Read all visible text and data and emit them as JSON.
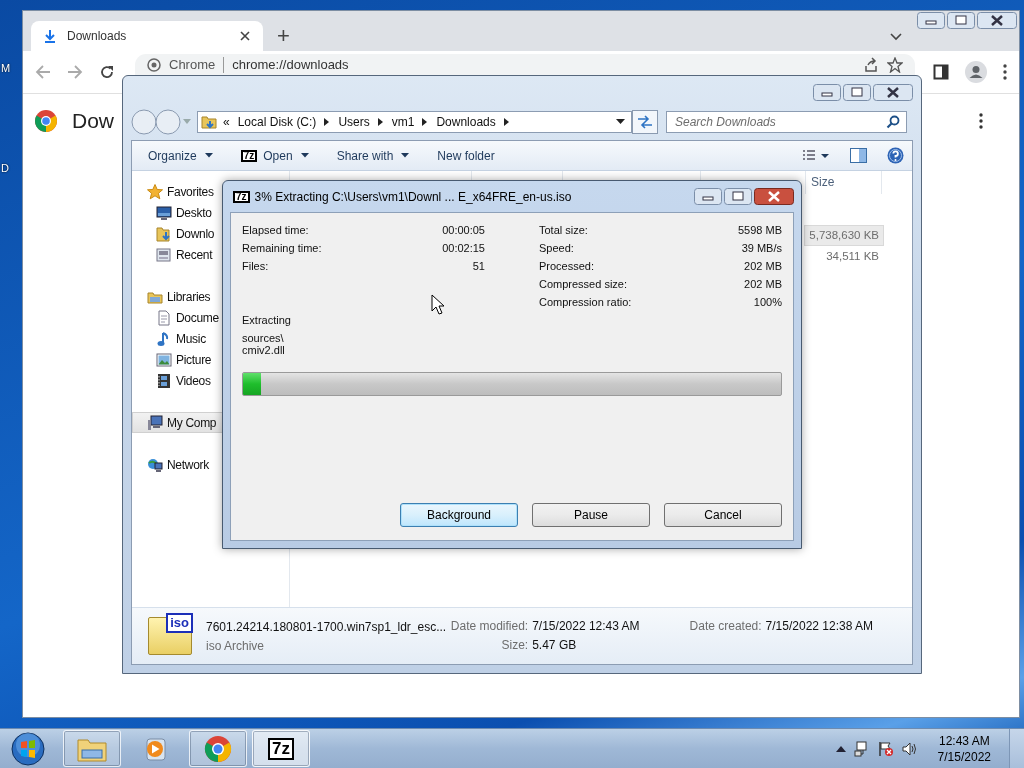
{
  "desktop": {
    "icon_labels": [
      "M",
      "D"
    ]
  },
  "browser": {
    "tabs": [
      {
        "title": "Downloads",
        "selected": true
      }
    ],
    "new_tab": "+",
    "omnibox": {
      "site_label": "Chrome",
      "url": "chrome://downloads"
    },
    "page_heading": "Dow"
  },
  "explorer": {
    "path_overflow": "«",
    "breadcrumb": [
      "Local Disk (C:)",
      "Users",
      "vm1",
      "Downloads"
    ],
    "search": {
      "placeholder": "Search Downloads"
    },
    "commands": [
      {
        "label": "Organize",
        "dropdown": true
      },
      {
        "label": "Open",
        "dropdown": true,
        "icon_text": "7z"
      },
      {
        "label": "Share with",
        "dropdown": true
      },
      {
        "label": "New folder",
        "dropdown": false
      }
    ],
    "nav": [
      {
        "label": "Favorites",
        "selected": false,
        "children": [
          {
            "label": "Deskto",
            "selected": false
          },
          {
            "label": "Downlo",
            "selected": false
          },
          {
            "label": "Recent",
            "selected": false
          }
        ]
      },
      {
        "label": "Libraries",
        "selected": false,
        "children": [
          {
            "label": "Docume",
            "selected": false
          },
          {
            "label": "Music",
            "selected": false
          },
          {
            "label": "Picture",
            "selected": false
          },
          {
            "label": "Videos",
            "selected": false
          }
        ]
      },
      {
        "label": "My Comp",
        "selected": true
      },
      {
        "label": "Network",
        "selected": false
      }
    ],
    "size_column": "Size",
    "rows": [
      {
        "size": "5,738,630 KB",
        "selected": true
      },
      {
        "size": "34,511 KB",
        "selected": false
      }
    ],
    "details": {
      "icon_text": "iso",
      "name": "7601.24214.180801-1700.win7sp1_ldr_esc...",
      "type": "iso Archive",
      "fields": [
        {
          "label": "Date modified:",
          "value": "7/15/2022 12:43 AM"
        },
        {
          "label": "Size:",
          "value": "5.47 GB"
        },
        {
          "label": "Date created:",
          "value": "7/15/2022 12:38 AM"
        }
      ]
    }
  },
  "dialog": {
    "icon_text": "7z",
    "title": "3% Extracting C:\\Users\\vm1\\Downl ... E_x64FRE_en-us.iso",
    "stats_left": [
      {
        "label": "Elapsed time:",
        "value": "00:00:05"
      },
      {
        "label": "Remaining time:",
        "value": "00:02:15"
      },
      {
        "label": "Files:",
        "value": "51"
      }
    ],
    "stats_right": [
      {
        "label": "Total size:",
        "value": "5598 MB"
      },
      {
        "label": "Speed:",
        "value": "39 MB/s"
      },
      {
        "label": "Processed:",
        "value": "202 MB"
      },
      {
        "label": "Compressed size:",
        "value": "202 MB"
      },
      {
        "label": "Compression ratio:",
        "value": "100%"
      }
    ],
    "status": "Extracting",
    "current_file": [
      "sources\\",
      "cmiv2.dll"
    ],
    "progress": {
      "level": 0.033
    },
    "buttons": [
      {
        "label": "Background",
        "focused": true
      },
      {
        "label": "Pause",
        "focused": false
      },
      {
        "label": "Cancel",
        "focused": false
      }
    ]
  },
  "taskbar": {
    "apps": [
      {
        "kind": "explorer",
        "running": true,
        "selected": false
      },
      {
        "kind": "media",
        "running": false,
        "selected": false
      },
      {
        "kind": "chrome",
        "running": true,
        "selected": false
      },
      {
        "kind": "sevenzip",
        "icon_text": "7z",
        "running": true,
        "selected": true
      }
    ],
    "clock": {
      "time": "12:43 AM",
      "date": "7/15/2022"
    }
  }
}
